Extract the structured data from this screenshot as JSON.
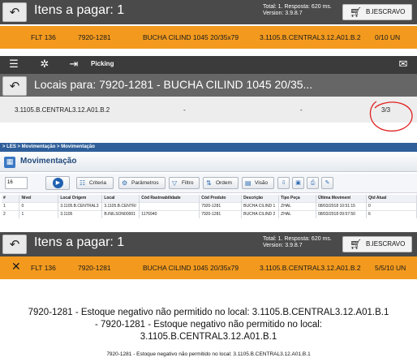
{
  "panel1": {
    "back_icon": "back-arrow-icon",
    "title": "Itens a pagar: 1",
    "meta_line1": "Total: 1. Resposta: 620 ms.",
    "meta_line2": "Version: 3.9.8.7",
    "user_icon": "cart-icon",
    "user_label": "B.IESCRAVO",
    "row": {
      "flight": "FLT 136",
      "code": "7920-1281",
      "description": "BUCHA CILIND 1045 20/35x79",
      "location": "3.1105.B.CENTRAL3.12.A01.B.2",
      "qty": "0/10 UN"
    }
  },
  "panel2": {
    "toolbar": {
      "menu_icon": "list-icon",
      "settings_icon": "gear-icon",
      "logout_icon": "logout-icon",
      "label": "Picking",
      "message_icon": "envelope-icon"
    },
    "back_icon": "back-arrow-icon",
    "title": "Locais para: 7920-1281 - BUCHA CILIND 1045 20/35...",
    "row": {
      "location": "3.1105.B.CENTRAL3.12.A01.B.2",
      "col2": "-",
      "col3": "-",
      "qty": "3/3"
    },
    "annotation_color": "#e02020"
  },
  "panel3": {
    "breadcrumb": "> LES > Movimentação > Movimentação",
    "title": "Movimentação",
    "page_size": "16",
    "buttons": {
      "criteria": "Criteria",
      "parametros": "Parâmetros",
      "filtro": "Filtro",
      "ordem": "Ordem",
      "visao": "Visão"
    },
    "columns": [
      "#",
      "Nível",
      "Local Origem",
      "Local",
      "Cód Rastreabilidade",
      "Cód Produto",
      "Descrição",
      "Tipo Peça",
      "Última Moviment",
      "Qtd Atual"
    ],
    "rows": [
      [
        "1",
        "0",
        "3.1105.B.CENTRAL3",
        "3.1105.B.CENTR/",
        "",
        "7920-1281",
        "BUCHA CILIND 1",
        "ZHAL",
        "08/03/2018 10:51:15",
        "0"
      ],
      [
        "2",
        "1",
        "3.1105",
        "B.INILSON00001",
        "1176940",
        "7920-1281",
        "BUCHA CILIND 2",
        "ZHAL",
        "08/03/2018 09:57:50",
        "6"
      ]
    ]
  },
  "panel4": {
    "back_icon": "back-arrow-icon",
    "title": "Itens a pagar: 1",
    "meta_line1": "Total: 1. Resposta: 620 ms.",
    "meta_line2": "Version: 3.9.8.7",
    "user_icon": "cart-icon",
    "user_label": "B.IESCRAVO",
    "row": {
      "close_icon": "x-icon",
      "flight": "FLT 136",
      "code": "7920-1281",
      "description": "BUCHA CILIND 1045 20/35x79",
      "location": "3.1105.B.CENTRAL3.12.A01.B.2",
      "qty": "5/5/10 UN"
    }
  },
  "panel5": {
    "big_line1": "7920-1281 - Estoque negativo não permitido no local: 3.1105.B.CENTRAL3.12.A01.B.1",
    "big_line2": "- 7920-1281 - Estoque negativo não permitido no local:",
    "big_line3": "3.1105.B.CENTRAL3.12.A01.B.1",
    "small_line": "7920-1281 - Estoque negativo não permitido no local: 3.1105.B.CENTRAL3.12.A01.B.1"
  },
  "colors": {
    "orange": "#f39a1e",
    "dark_header": "#4a4a4a",
    "gray_header": "#666666",
    "les_blue": "#2e5f9a"
  }
}
